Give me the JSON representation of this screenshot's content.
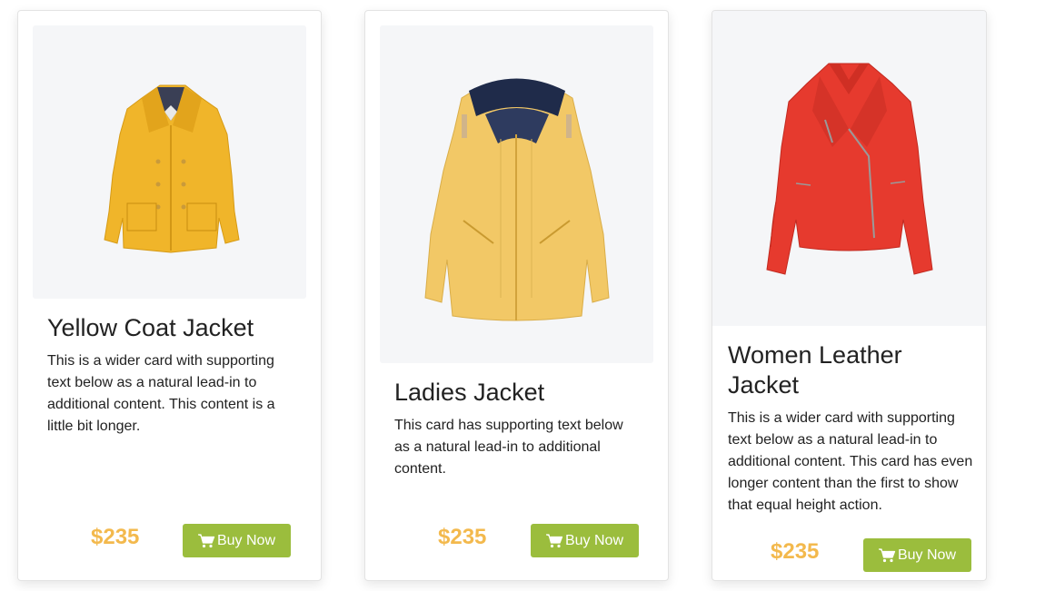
{
  "colors": {
    "price": "#f3b94d",
    "button": "#9bbd3d",
    "image_background": "#f5f6f8"
  },
  "cards": [
    {
      "image_icon": "yellow-coat-image",
      "title": "Yellow Coat Jacket",
      "description": "This is a wider card with supporting text below as a natural lead-in to additional content. This content is a little bit longer.",
      "price": "$235",
      "button_label": "Buy Now",
      "button_icon": "cart-icon"
    },
    {
      "image_icon": "ladies-jacket-image",
      "title": "Ladies Jacket",
      "description": "This card has supporting text below as a natural lead-in to additional content.",
      "price": "$235",
      "button_label": "Buy Now",
      "button_icon": "cart-icon"
    },
    {
      "image_icon": "leather-jacket-image",
      "title": "Women Leather Jacket",
      "description": "This is a wider card with supporting text below as a natural lead-in to additional content. This card has even longer content than the first to show that equal height action.",
      "price": "$235",
      "button_label": "Buy Now",
      "button_icon": "cart-icon"
    }
  ]
}
